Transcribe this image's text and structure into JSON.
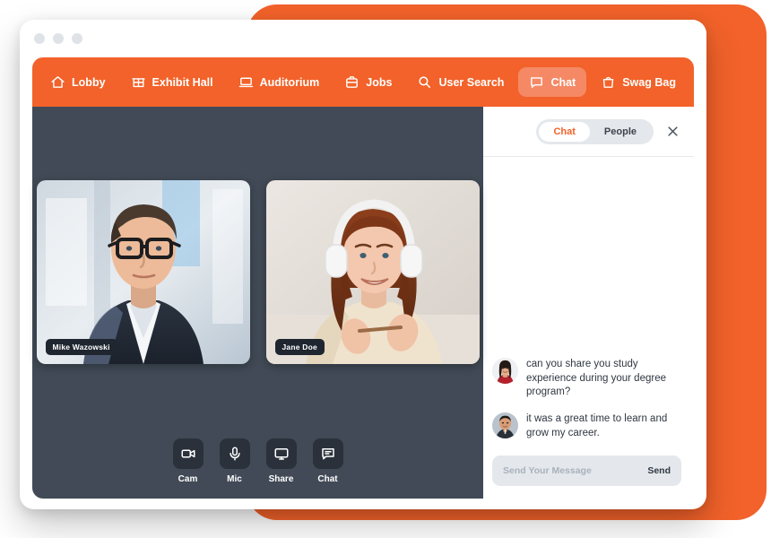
{
  "colors": {
    "brand_orange": "#f2622a",
    "nav_active": "#f58965",
    "video_bg": "#414a56",
    "control_btn": "#2b313b",
    "panel_gray": "#e4e8ec"
  },
  "window": {
    "traffic_lights": [
      "close",
      "minimize",
      "maximize"
    ]
  },
  "nav": {
    "items": [
      {
        "label": "Lobby",
        "icon": "home-icon",
        "active": false
      },
      {
        "label": "Exhibit Hall",
        "icon": "storefront-icon",
        "active": false
      },
      {
        "label": "Auditorium",
        "icon": "laptop-icon",
        "active": false
      },
      {
        "label": "Jobs",
        "icon": "briefcase-icon",
        "active": false
      },
      {
        "label": "User Search",
        "icon": "search-icon",
        "active": false
      },
      {
        "label": "Chat",
        "icon": "chat-bubble-icon",
        "active": true
      },
      {
        "label": "Swag Bag",
        "icon": "shopping-bag-icon",
        "active": false
      }
    ]
  },
  "video": {
    "participants": [
      {
        "name": "Mike Wazowski"
      },
      {
        "name": "Jane Doe"
      }
    ],
    "controls": [
      {
        "label": "Cam",
        "icon": "video-camera-icon"
      },
      {
        "label": "Mic",
        "icon": "microphone-icon"
      },
      {
        "label": "Share",
        "icon": "monitor-icon"
      },
      {
        "label": "Chat",
        "icon": "chat-bubble-icon"
      }
    ]
  },
  "chat": {
    "tabs": [
      {
        "label": "Chat",
        "active": true
      },
      {
        "label": "People",
        "active": false
      }
    ],
    "close_icon": "close-icon",
    "messages": [
      {
        "avatar": "woman-avatar",
        "text": "can you share you study experience during your degree program?"
      },
      {
        "avatar": "man-avatar",
        "text": "it was a great time to learn and grow my career."
      }
    ],
    "composer": {
      "placeholder": "Send Your Message",
      "value": "",
      "send_label": "Send"
    }
  }
}
